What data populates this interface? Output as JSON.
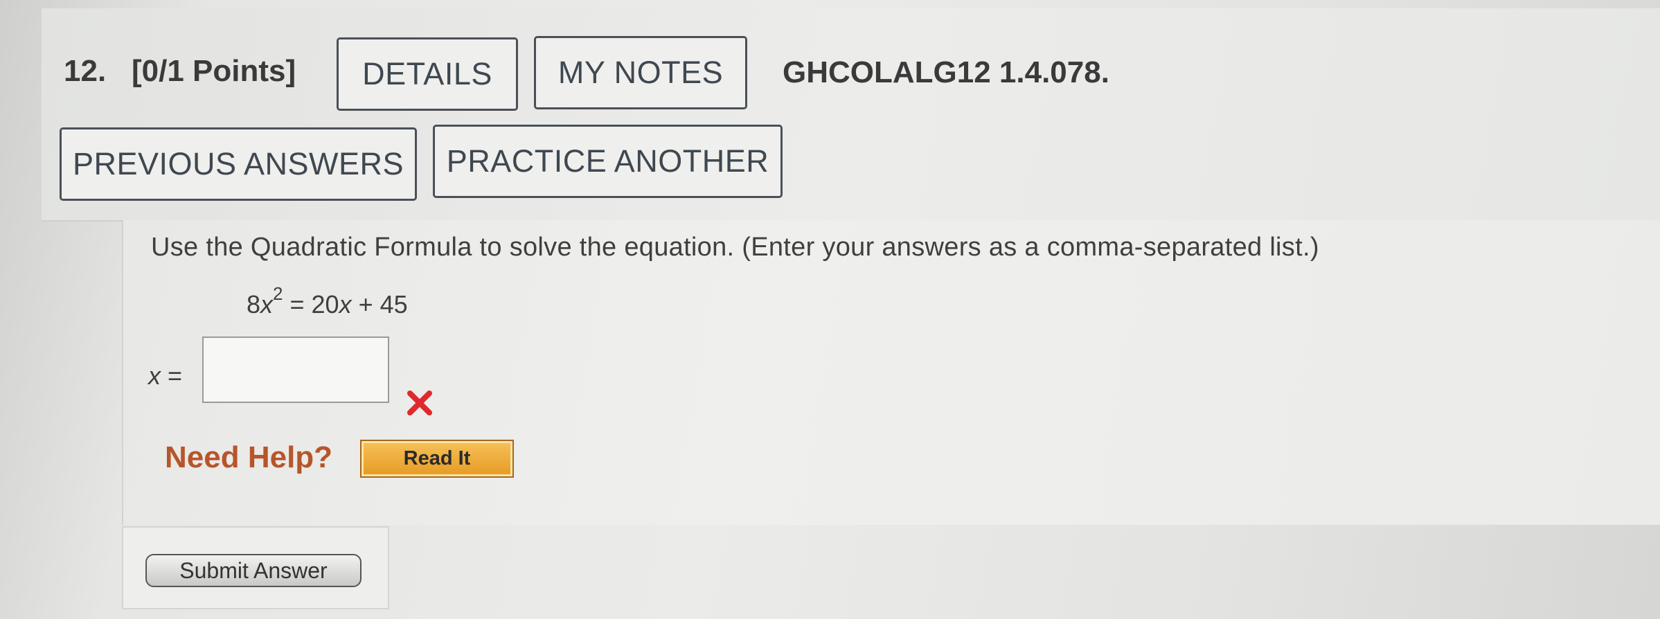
{
  "question": {
    "number": "12.",
    "points": "[0/1 Points]",
    "assignment_code": "GHCOLALG12 1.4.078."
  },
  "header_buttons": {
    "details": "DETAILS",
    "my_notes": "MY NOTES",
    "previous_answers": "PREVIOUS ANSWERS",
    "practice_another": "PRACTICE ANOTHER"
  },
  "body": {
    "instructions": "Use the Quadratic Formula to solve the equation. (Enter your answers as a comma-separated list.)",
    "equation": {
      "coefficient": "8",
      "variable": "x",
      "exponent": "2",
      "rhs_prefix": " = 20",
      "rhs_variable": "x",
      "rhs_suffix": " + 45"
    },
    "answer": {
      "variable": "x",
      "equals": " =",
      "value": "",
      "status": "incorrect",
      "status_color": "#e0282e"
    }
  },
  "help": {
    "label": "Need Help?",
    "read_it": "Read It",
    "label_color": "#b7552a"
  },
  "submit": {
    "label": "Submit Answer"
  }
}
